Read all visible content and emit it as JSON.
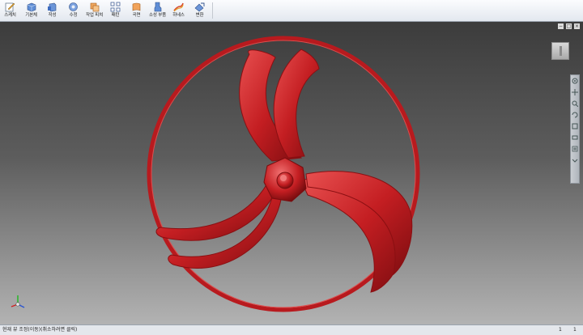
{
  "toolbar": {
    "tools": [
      {
        "label": "스케치",
        "icon": "sketch-icon"
      },
      {
        "label": "기본체",
        "icon": "primitive-box-icon"
      },
      {
        "label": "작성",
        "icon": "create-icon"
      },
      {
        "label": "수정",
        "icon": "modify-icon"
      },
      {
        "label": "작업 피쳐",
        "icon": "work-feature-icon"
      },
      {
        "label": "패턴",
        "icon": "pattern-icon"
      },
      {
        "label": "곡면",
        "icon": "surface-icon"
      },
      {
        "label": "소성 부품",
        "icon": "plastic-part-icon"
      },
      {
        "label": "하네스",
        "icon": "harness-icon"
      },
      {
        "label": "변환",
        "icon": "convert-icon"
      }
    ]
  },
  "viewport": {
    "model_color": "#c41e22",
    "window_controls": [
      "−",
      "□",
      "×"
    ]
  },
  "status": {
    "text": "현재 뷰 조정(이동)(취소하려면 클릭)",
    "count1": "1",
    "count2": "1"
  }
}
